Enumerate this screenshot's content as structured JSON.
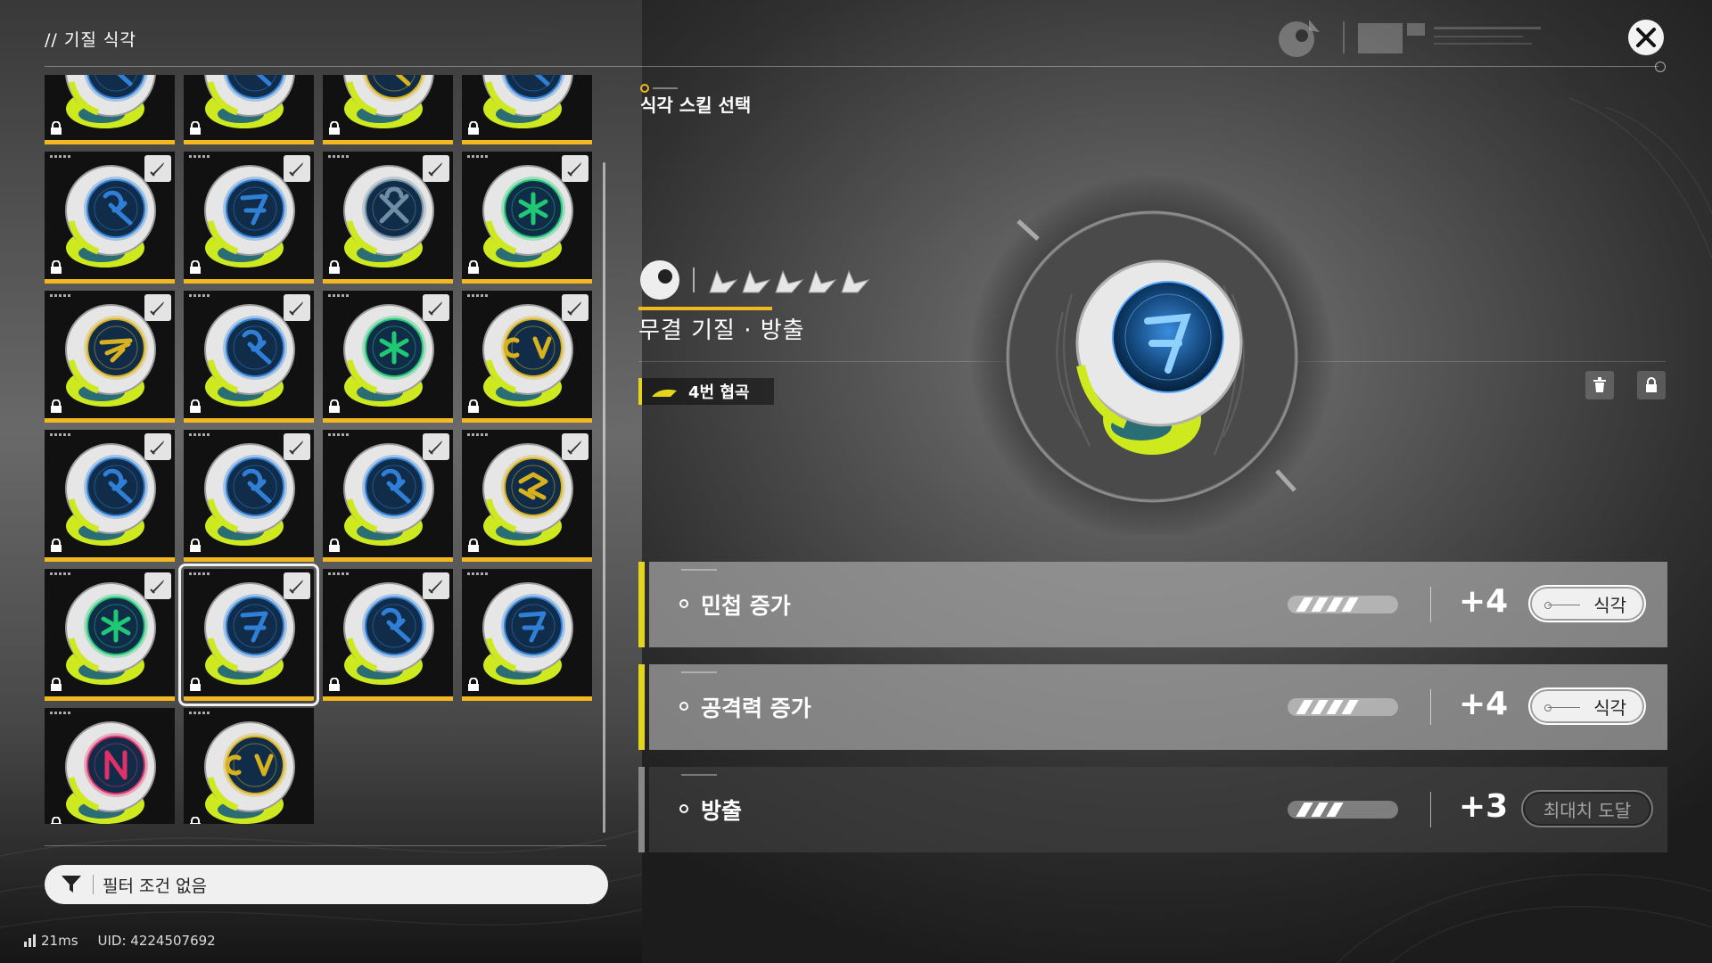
{
  "header": {
    "title": "// 기질 식각"
  },
  "cards": [
    {
      "glyph": "R",
      "color": "#2f7fd6",
      "equipped": false
    },
    {
      "glyph": "R",
      "color": "#2f7fd6",
      "equipped": false
    },
    {
      "glyph": "R",
      "color": "#d7b21e",
      "equipped": false
    },
    {
      "glyph": "R",
      "color": "#2f7fd6",
      "equipped": false
    },
    {
      "glyph": "R",
      "color": "#2f7fd6",
      "equipped": true
    },
    {
      "glyph": "K",
      "color": "#2f7fd6",
      "equipped": true
    },
    {
      "glyph": "X",
      "color": "#6f8da3",
      "equipped": true
    },
    {
      "glyph": "*",
      "color": "#1fc873",
      "equipped": true
    },
    {
      "glyph": "F",
      "color": "#d7b21e",
      "equipped": true
    },
    {
      "glyph": "R",
      "color": "#2f7fd6",
      "equipped": true
    },
    {
      "glyph": "*",
      "color": "#1fc873",
      "equipped": true
    },
    {
      "glyph": "O",
      "color": "#d7b21e",
      "equipped": true
    },
    {
      "glyph": "R",
      "color": "#2f7fd6",
      "equipped": true
    },
    {
      "glyph": "R",
      "color": "#2f7fd6",
      "equipped": true
    },
    {
      "glyph": "R",
      "color": "#2f7fd6",
      "equipped": true
    },
    {
      "glyph": "S",
      "color": "#d7b21e",
      "equipped": true
    },
    {
      "glyph": "*",
      "color": "#1fc873",
      "equipped": true
    },
    {
      "glyph": "K",
      "color": "#2f7fd6",
      "equipped": true,
      "selected": true
    },
    {
      "glyph": "R",
      "color": "#2f7fd6",
      "equipped": true
    },
    {
      "glyph": "K",
      "color": "#2f7fd6",
      "equipped": false
    },
    {
      "glyph": "N",
      "color": "#e0306a",
      "equipped": false
    },
    {
      "glyph": "O",
      "color": "#d7b21e",
      "equipped": false
    }
  ],
  "filter": {
    "label": "필터 조건 없음",
    "icon": "funnel-icon"
  },
  "status": {
    "ping": "21ms",
    "uid": "UID: 4224507692"
  },
  "panel": {
    "heading": "식각 스킬 선택",
    "stars": 5,
    "stone_name": "무결 기질 · 방출",
    "tag": "4번 협곡"
  },
  "skills": [
    {
      "label": "민첩 증가",
      "value": "+4",
      "level": 4,
      "max_level": 5,
      "button": "식각",
      "maxed": false
    },
    {
      "label": "공격력 증가",
      "value": "+4",
      "level": 4,
      "max_level": 5,
      "button": "식각",
      "maxed": false
    },
    {
      "label": "방출",
      "value": "+3",
      "level": 3,
      "max_level": 5,
      "button": "최대치 도달",
      "maxed": true
    }
  ],
  "colors": {
    "accent_yellow": "#f2b81f",
    "tag_bar": "#e3d51d",
    "orb_glow": "#2f7fd6"
  }
}
